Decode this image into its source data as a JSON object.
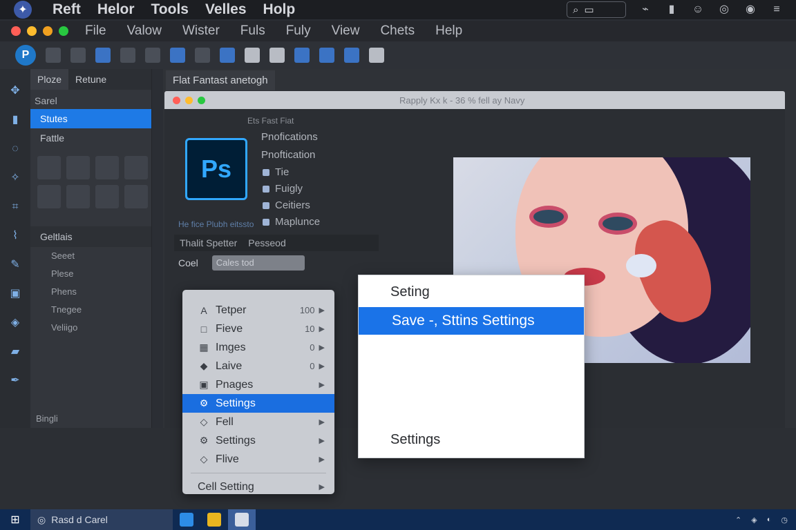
{
  "os_bar": {
    "menu": [
      "Reft",
      "Helor",
      "Tools",
      "Velles",
      "Holp"
    ]
  },
  "app_bar": {
    "menu": [
      "File",
      "Valow",
      "Wister",
      "Fuls",
      "Fuly",
      "View",
      "Chets",
      "Help"
    ]
  },
  "left_panel": {
    "tabs": [
      "Ploze",
      "Retune"
    ],
    "search_label": "Sarel",
    "items": [
      "Stutes",
      "Fattle"
    ],
    "section": "Geltlais",
    "sub_items": [
      "Seeet",
      "Plese",
      "Phens",
      "Tnegee",
      "Veliigo"
    ],
    "footer": "Bingli"
  },
  "document": {
    "tab_title": "Flat Fantast anetogh",
    "window_title": "Rapply Kx k - 36 % fell ay Navy",
    "app_logo": "Ps",
    "info_header": "Ets Fast Fiat",
    "info_headings": [
      "Pnofications",
      "Pnoftication"
    ],
    "info_checks": [
      "Tie",
      "Fuigly",
      "Ceitiers",
      "Maplunce"
    ],
    "caption": "He fice Plubh eitssto",
    "field_labels": [
      "Thalit Spetter",
      "Pesseod"
    ],
    "select_label": "Coel",
    "select_value": "Cales tod"
  },
  "context_menu": {
    "items": [
      {
        "icon": "A",
        "label": "Tetper",
        "shortcut": "100",
        "arrow": "▶"
      },
      {
        "icon": "□",
        "label": "Fieve",
        "shortcut": "10",
        "arrow": "▶"
      },
      {
        "icon": "▦",
        "label": "Imges",
        "shortcut": "0",
        "arrow": "▶"
      },
      {
        "icon": "◆",
        "label": "Laive",
        "shortcut": "0",
        "arrow": "▶"
      },
      {
        "icon": "▣",
        "label": "Pnages",
        "shortcut": "",
        "arrow": "▶"
      },
      {
        "icon": "⚙",
        "label": "Settings",
        "shortcut": "",
        "arrow": ""
      },
      {
        "icon": "◇",
        "label": "Fell",
        "shortcut": "",
        "arrow": "▶"
      },
      {
        "icon": "⚙",
        "label": "Settings",
        "shortcut": "",
        "arrow": "▶"
      },
      {
        "icon": "◇",
        "label": "Flive",
        "shortcut": "",
        "arrow": "▶"
      }
    ],
    "footer_item": {
      "label": "Cell Setting",
      "arrow": "▶"
    },
    "selected_index": 5
  },
  "settings_dialog": {
    "title": "Seting",
    "selected_item": "Save -, Sttins Settings",
    "footer_item": "Settings"
  },
  "taskbar": {
    "search_text": "Rasd d Carel"
  },
  "colors": {
    "accent": "#1a73e8",
    "selection": "#1e7ae6",
    "taskbar": "#0f2a52",
    "ps_blue": "#31a8ff"
  }
}
